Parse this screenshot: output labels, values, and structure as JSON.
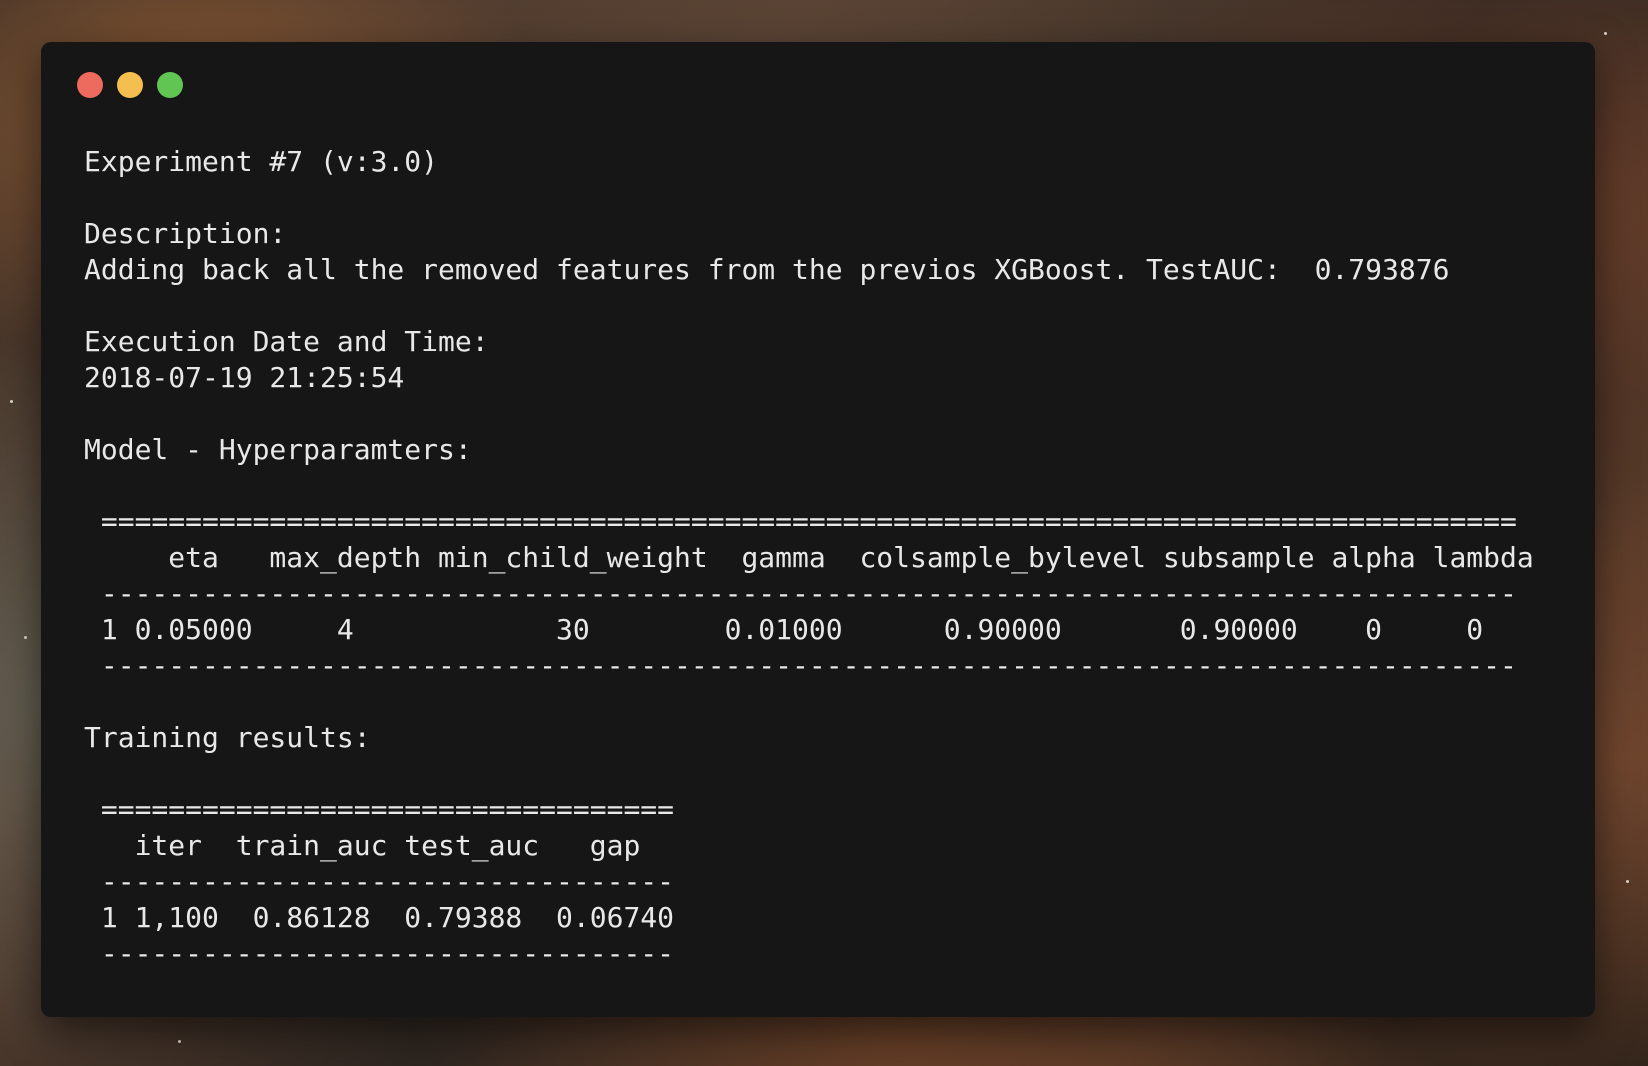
{
  "window": {
    "controls": [
      {
        "name": "close",
        "color": "#ed6a5e"
      },
      {
        "name": "minimize",
        "color": "#f5bf4f"
      },
      {
        "name": "maximize",
        "color": "#61c554"
      }
    ]
  },
  "terminal": {
    "lines": [
      "Experiment #7 (v:3.0)",
      "",
      "Description:",
      "Adding back all the removed features from the previos XGBoost. TestAUC:  0.793876",
      "",
      "Execution Date and Time:",
      "2018-07-19 21:25:54",
      "",
      "Model - Hyperparamters:",
      "",
      " ====================================================================================",
      "     eta   max_depth min_child_weight  gamma  colsample_bylevel subsample alpha lambda",
      " ------------------------------------------------------------------------------------",
      " 1 0.05000     4            30        0.01000      0.90000       0.90000    0     0   ",
      " ------------------------------------------------------------------------------------",
      "",
      "Training results:",
      "",
      " ==================================",
      "   iter  train_auc test_auc   gap",
      " ----------------------------------",
      " 1 1,100  0.86128  0.79388  0.06740",
      " ----------------------------------"
    ]
  }
}
